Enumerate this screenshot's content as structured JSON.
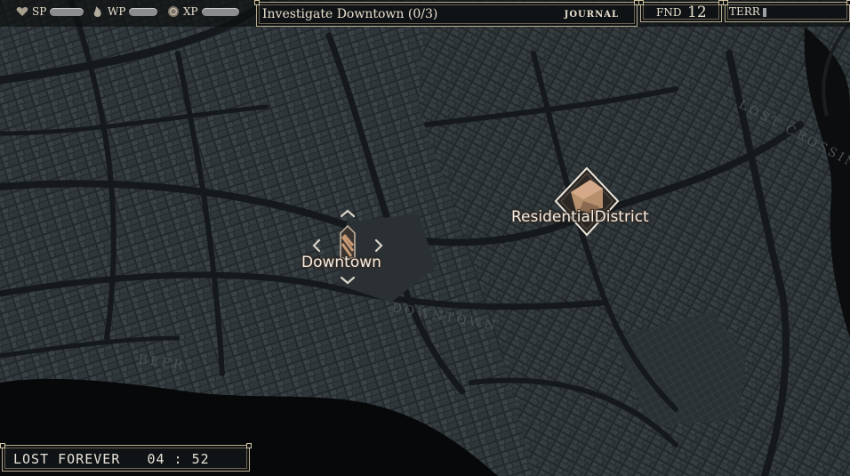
{
  "hud": {
    "sp_label": "SP",
    "wp_label": "WP",
    "xp_label": "XP",
    "sp_icon": "heart-icon",
    "wp_icon": "flame-icon",
    "xp_icon": "coin-icon"
  },
  "quest": {
    "title": "Investigate Downtown (0/3)",
    "journal_label": "JOURNAL"
  },
  "fnd": {
    "label": "FND",
    "value": "12"
  },
  "terr": {
    "label": "TERR"
  },
  "map": {
    "markers": [
      {
        "label": "Downtown",
        "icon": "lighthouse-icon"
      },
      {
        "label": "ResidentialDistrict",
        "icon": "house-icon"
      }
    ],
    "street_labels": [
      "LOST CROSSING",
      "DOWNTOWN",
      "BEER"
    ]
  },
  "status": {
    "text": "LOST FOREVER   04 : 52"
  },
  "colors": {
    "frame": "#b9ac8f",
    "map_bg": "#2a3033",
    "water": "#0a0b0c",
    "bar": "#8a8c8e"
  }
}
